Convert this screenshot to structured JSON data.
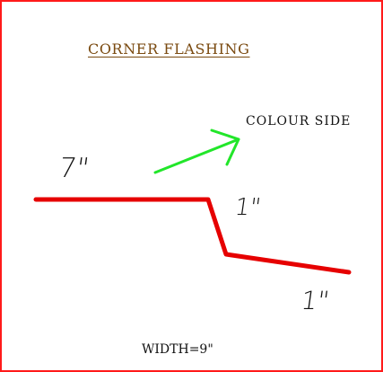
{
  "diagram": {
    "title": "CORNER  FLASHING",
    "colour_side_label": "COLOUR  SIDE",
    "dimension_top": "7\"",
    "dimension_drop": "1\"",
    "dimension_return": "1\"",
    "width_label": "WIDTH=9\""
  },
  "colors": {
    "border": "#ff1a1a",
    "flashing_profile": "#e60000",
    "arrow": "#22e62a",
    "title": "#7a4a10",
    "text": "#111111"
  },
  "icons": {
    "arrow": "arrow-up-right-icon"
  }
}
